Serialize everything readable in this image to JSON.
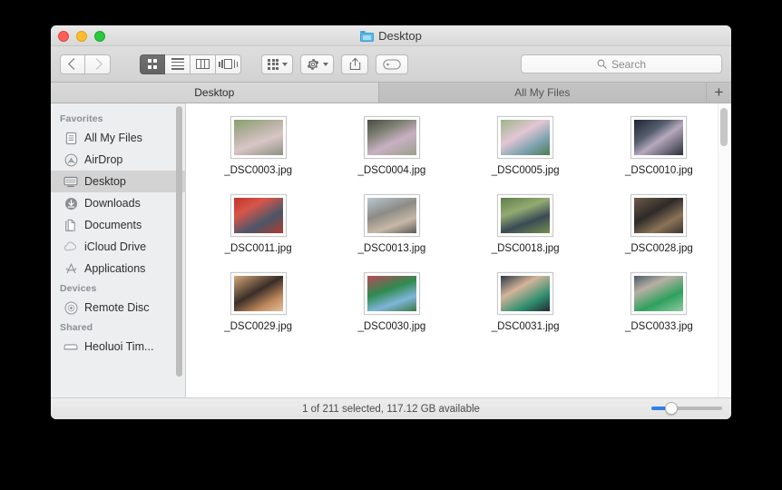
{
  "window": {
    "title": "Desktop",
    "title_icon": "folder-icon",
    "traffic_lights": [
      {
        "name": "close-button",
        "color": "#ff5f57"
      },
      {
        "name": "minimize-button",
        "color": "#ffbd2e"
      },
      {
        "name": "zoom-button",
        "color": "#28c840"
      }
    ]
  },
  "toolbar": {
    "back_icon": "chevron-left-icon",
    "forward_icon": "chevron-right-icon",
    "view_modes": [
      {
        "name": "icon-view",
        "icon": "grid-icon",
        "active": true
      },
      {
        "name": "list-view",
        "icon": "list-icon",
        "active": false
      },
      {
        "name": "column-view",
        "icon": "columns-icon",
        "active": false
      },
      {
        "name": "coverflow-view",
        "icon": "coverflow-icon",
        "active": false
      }
    ],
    "arrange_icon": "arrange-grid-icon",
    "action_icon": "gear-icon",
    "share_icon": "share-icon",
    "tag_icon": "tag-icon"
  },
  "search": {
    "placeholder": "Search",
    "icon": "search-icon",
    "value": ""
  },
  "tabs": {
    "items": [
      {
        "label": "Desktop",
        "active": true
      },
      {
        "label": "All My Files",
        "active": false
      }
    ],
    "add_label": "+"
  },
  "sidebar": {
    "sections": [
      {
        "title": "Favorites",
        "items": [
          {
            "label": "All My Files",
            "icon": "all-my-files-icon",
            "selected": false
          },
          {
            "label": "AirDrop",
            "icon": "airdrop-icon",
            "selected": false
          },
          {
            "label": "Desktop",
            "icon": "desktop-icon",
            "selected": true
          },
          {
            "label": "Downloads",
            "icon": "downloads-icon",
            "selected": false
          },
          {
            "label": "Documents",
            "icon": "documents-icon",
            "selected": false
          },
          {
            "label": "iCloud Drive",
            "icon": "icloud-icon",
            "selected": false
          },
          {
            "label": "Applications",
            "icon": "applications-icon",
            "selected": false
          }
        ]
      },
      {
        "title": "Devices",
        "items": [
          {
            "label": "Remote Disc",
            "icon": "disc-icon",
            "selected": false
          }
        ]
      },
      {
        "title": "Shared",
        "items": [
          {
            "label": "Heoluoi Tim...",
            "icon": "shared-computer-icon",
            "selected": false
          }
        ]
      }
    ]
  },
  "files": [
    {
      "name": "_DSC0003.jpg",
      "thumb": "linear-gradient(160deg,#86a06c 0%,#b9b2a4 35%,#d8c6c6 60%,#8e8f84 100%)"
    },
    {
      "name": "_DSC0004.jpg",
      "thumb": "linear-gradient(155deg,#4a4a44 0%,#7d7f72 30%,#c8b0c2 60%,#9aa08c 100%)"
    },
    {
      "name": "_DSC0005.jpg",
      "thumb": "linear-gradient(150deg,#9fb488 0%,#e3c6d4 40%,#7fa3b0 70%,#4d7b56 100%)"
    },
    {
      "name": "_DSC0010.jpg",
      "thumb": "linear-gradient(145deg,#1d2430 0%,#575f70 35%,#b6a9bd 55%,#2a2f3a 100%)"
    },
    {
      "name": "_DSC0011.jpg",
      "thumb": "linear-gradient(150deg,#c0342c 0%,#d8554a 30%,#4a5668 65%,#b03a30 100%)"
    },
    {
      "name": "_DSC0013.jpg",
      "thumb": "linear-gradient(160deg,#b9c7d2 0%,#8d8b86 40%,#c7b8a8 70%,#5c5a56 100%)"
    },
    {
      "name": "_DSC0018.jpg",
      "thumb": "linear-gradient(160deg,#5f7d4a 0%,#93ab72 35%,#3a4a55 65%,#76904f 100%)"
    },
    {
      "name": "_DSC0028.jpg",
      "thumb": "linear-gradient(150deg,#6d5a48 0%,#2e2a28 40%,#8b7358 70%,#3a3430 100%)"
    },
    {
      "name": "_DSC0029.jpg",
      "thumb": "linear-gradient(150deg,#d8a878 0%,#3a2e28 45%,#c08a5c 75%,#e0c0a0 100%)"
    },
    {
      "name": "_DSC0030.jpg",
      "thumb": "linear-gradient(160deg,#b84a5a 0%,#2f8b4e 40%,#7fb4d8 70%,#3a7a45 100%)"
    },
    {
      "name": "_DSC0031.jpg",
      "thumb": "linear-gradient(150deg,#2b3a46 0%,#d3b49a 35%,#2f8f6e 70%,#1f2a33 100%)"
    },
    {
      "name": "_DSC0033.jpg",
      "thumb": "linear-gradient(155deg,#4a5a66 0%,#b8b0a4 30%,#2fa05e 65%,#8fc8a0 100%)"
    }
  ],
  "status": {
    "text": "1 of 211 selected, 117.12 GB available",
    "zoom_percent": 25
  }
}
